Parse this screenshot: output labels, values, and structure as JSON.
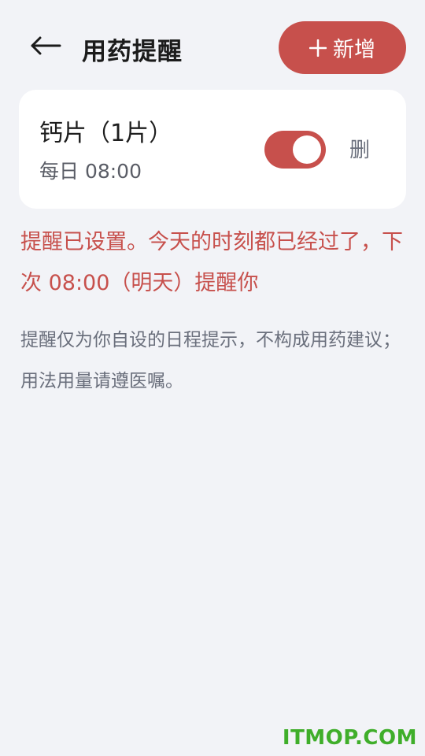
{
  "header": {
    "title": "用药提醒",
    "back_icon": "arrow-left-icon",
    "add_button": {
      "label": "新增",
      "icon": "plus-icon"
    }
  },
  "reminder": {
    "name": "钙片（1片）",
    "schedule": "每日 08:00",
    "enabled": true,
    "delete_label": "删"
  },
  "status_message": "提醒已设置。今天的时刻都已经过了，下次 08:00（明天）提醒你",
  "disclaimer": "提醒仅为你自设的日程提示，不构成用药建议；用法用量请遵医嘱。",
  "watermark": "ITMOP.COM",
  "colors": {
    "accent": "#c7504c",
    "background": "#f2f3f7",
    "card": "#ffffff",
    "watermark": "#3fae2a"
  }
}
